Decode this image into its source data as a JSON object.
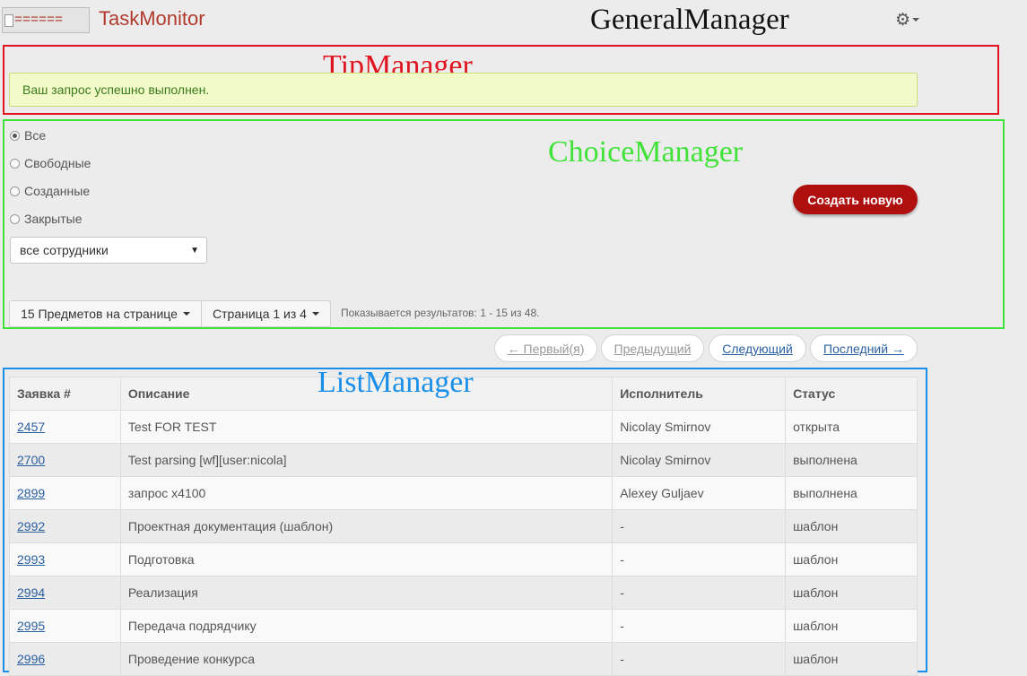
{
  "header": {
    "logo_alt": "======",
    "brand": "TaskMonitor",
    "general_manager_label": "GeneralManager",
    "settings_icon": "gear-icon"
  },
  "tip_manager": {
    "label": "TipManager",
    "alert_text": "Ваш запрос успешно выполнен."
  },
  "choice_manager": {
    "label": "ChoiceManager",
    "filters": [
      {
        "label": "Все",
        "checked": true
      },
      {
        "label": "Свободные",
        "checked": false
      },
      {
        "label": "Созданные",
        "checked": false
      },
      {
        "label": "Закрытые",
        "checked": false
      }
    ],
    "employee_select": "все сотрудники",
    "create_button": "Создать новую",
    "per_page_button": "15 Предметов на странице",
    "page_button": "Страница 1 из 4",
    "results_text": "Показывается результатов: 1 - 15 из 48."
  },
  "pager": {
    "first": "← Первый(я)",
    "prev": "Предыдущий",
    "next": "Следующий",
    "last": "Последний →"
  },
  "list_manager": {
    "label": "ListManager",
    "columns": [
      "Заявка #",
      "Описание",
      "Исполнитель",
      "Статус"
    ],
    "rows": [
      [
        "2457",
        "Test FOR TEST",
        "Nicolay Smirnov",
        "открыта"
      ],
      [
        "2700",
        "Test parsing [wf][user:nicola]",
        "Nicolay Smirnov",
        "выполнена"
      ],
      [
        "2899",
        "запрос х4100",
        "Alexey Guljaev",
        "выполнена"
      ],
      [
        "2992",
        "Проектная документация (шаблон)",
        "-",
        "шаблон"
      ],
      [
        "2993",
        "Подготовка",
        "-",
        "шаблон"
      ],
      [
        "2994",
        "Реализация",
        "-",
        "шаблон"
      ],
      [
        "2995",
        "Передача подрядчику",
        "-",
        "шаблон"
      ],
      [
        "2996",
        "Проведение конкурса",
        "-",
        "шаблон"
      ]
    ]
  },
  "colors": {
    "brand": "#b03a2e",
    "tip_border": "#e0141e",
    "choice_border": "#3fe23a",
    "list_border": "#1a8fe8",
    "create_button": "#b00f0f",
    "link": "#2a5fa0"
  }
}
